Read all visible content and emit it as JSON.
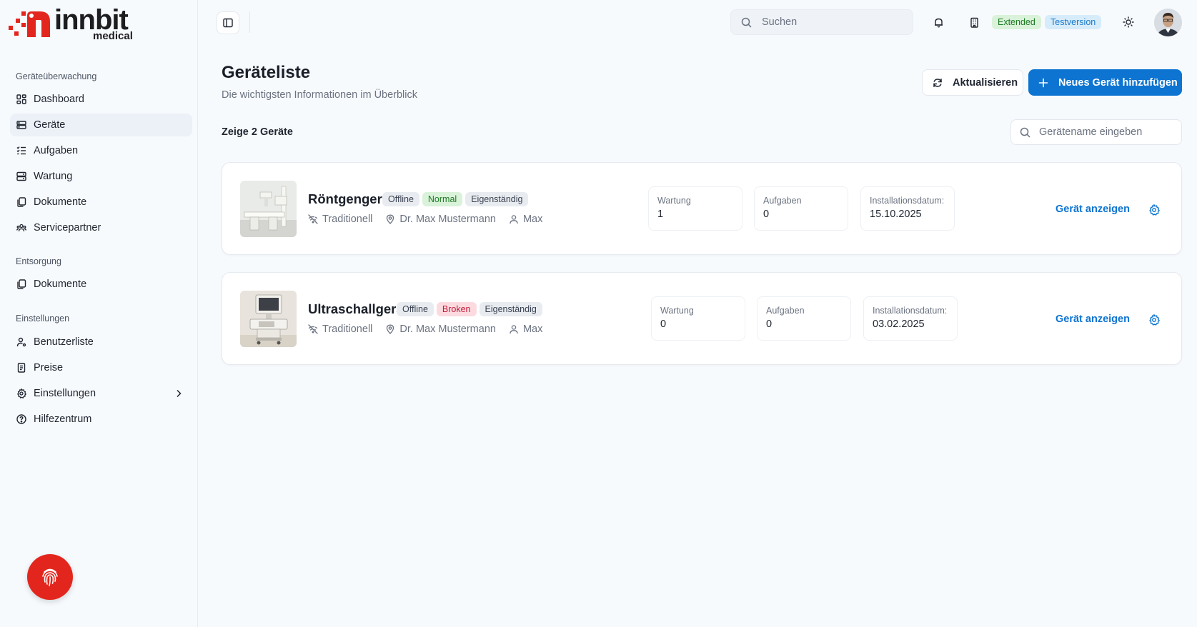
{
  "brand": {
    "name": "innbit",
    "sub": "medical",
    "color": "#e3261d"
  },
  "sidebar": {
    "sections": [
      {
        "title": "Geräteüberwachung"
      },
      {
        "title": "Entsorgung"
      },
      {
        "title": "Einstellungen"
      }
    ],
    "items": [
      {
        "label": "Dashboard",
        "icon": "dashboard-icon"
      },
      {
        "label": "Geräte",
        "icon": "devices-icon",
        "active": true
      },
      {
        "label": "Aufgaben",
        "icon": "tasks-icon"
      },
      {
        "label": "Wartung",
        "icon": "maintenance-icon"
      },
      {
        "label": "Dokumente",
        "icon": "documents-icon"
      },
      {
        "label": "Servicepartner",
        "icon": "partners-icon"
      },
      {
        "label": "Dokumente",
        "icon": "documents-icon"
      },
      {
        "label": "Benutzerliste",
        "icon": "user-list-icon"
      },
      {
        "label": "Preise",
        "icon": "prices-icon"
      },
      {
        "label": "Einstellungen",
        "icon": "settings-icon"
      },
      {
        "label": "Hilfezentrum",
        "icon": "help-icon"
      }
    ]
  },
  "header": {
    "search_placeholder": "Suchen",
    "badge_extended": "Extended",
    "badge_test": "Testversion"
  },
  "page": {
    "title": "Geräteliste",
    "subtitle": "Die wichtigsten Informationen im Überblick",
    "refresh_label": "Aktualisieren",
    "new_label": "Neues Gerät hinzufügen",
    "count_label": "Zeige 2 Geräte",
    "filter_placeholder": "Gerätename eingeben"
  },
  "devices": [
    {
      "name": "Röntgengerät",
      "status": "Offline",
      "condition": "Normal",
      "ownership": "Eigenständig",
      "type": "Traditionell",
      "location": "Dr. Max Mustermann",
      "owner": "Max",
      "maintenance_label": "Wartung",
      "maintenance": "1",
      "tasks_label": "Aufgaben",
      "tasks": "0",
      "install_label": "Installationsdatum:",
      "install_date": "15.10.2025",
      "view_label": "Gerät anzeigen"
    },
    {
      "name": "Ultraschallgerät",
      "status": "Offline",
      "condition": "Broken",
      "ownership": "Eigenständig",
      "type": "Traditionell",
      "location": "Dr. Max Mustermann",
      "owner": "Max",
      "maintenance_label": "Wartung",
      "maintenance": "0",
      "tasks_label": "Aufgaben",
      "tasks": "0",
      "install_label": "Installationsdatum:",
      "install_date": "03.02.2025",
      "view_label": "Gerät anzeigen"
    }
  ]
}
